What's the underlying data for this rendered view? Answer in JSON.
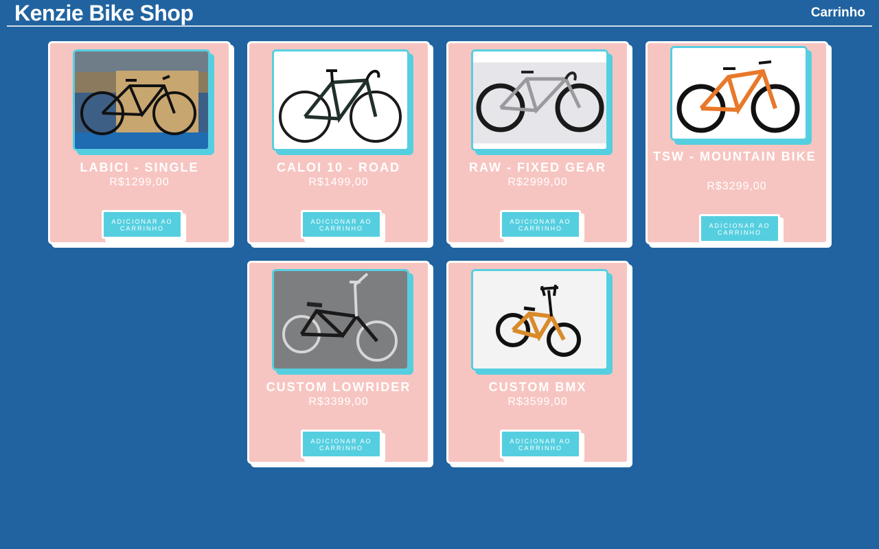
{
  "header": {
    "title": "Kenzie Bike Shop",
    "cart_label": "Carrinho"
  },
  "colors": {
    "background": "#2063a0",
    "card": "#f7c5c1",
    "accent": "#55cfe0",
    "border": "#ffffff"
  },
  "products": [
    {
      "name": "LABICI - SINGLE",
      "price": "R$1299,00",
      "button_label": "ADICIONAR AO CARRINHO",
      "image": "black single-speed bike in a store"
    },
    {
      "name": "CALOI 10 - ROAD",
      "price": "R$1499,00",
      "button_label": "ADICIONAR AO CARRINHO",
      "image": "black road bike"
    },
    {
      "name": "RAW - FIXED GEAR",
      "price": "R$2999,00",
      "button_label": "ADICIONAR AO CARRINHO",
      "image": "silver fixed gear bike"
    },
    {
      "name": "TSW - MOUNTAIN BIKE",
      "price": "R$3299,00",
      "button_label": "ADICIONAR AO CARRINHO",
      "image": "orange and black mountain bike"
    },
    {
      "name": "CUSTOM LOWRIDER",
      "price": "R$3399,00",
      "button_label": "ADICIONAR AO CARRINHO",
      "image": "chrome lowrider bike on asphalt"
    },
    {
      "name": "CUSTOM BMX",
      "price": "R$3599,00",
      "button_label": "ADICIONAR AO CARRINHO",
      "image": "orange BMX bike"
    }
  ]
}
